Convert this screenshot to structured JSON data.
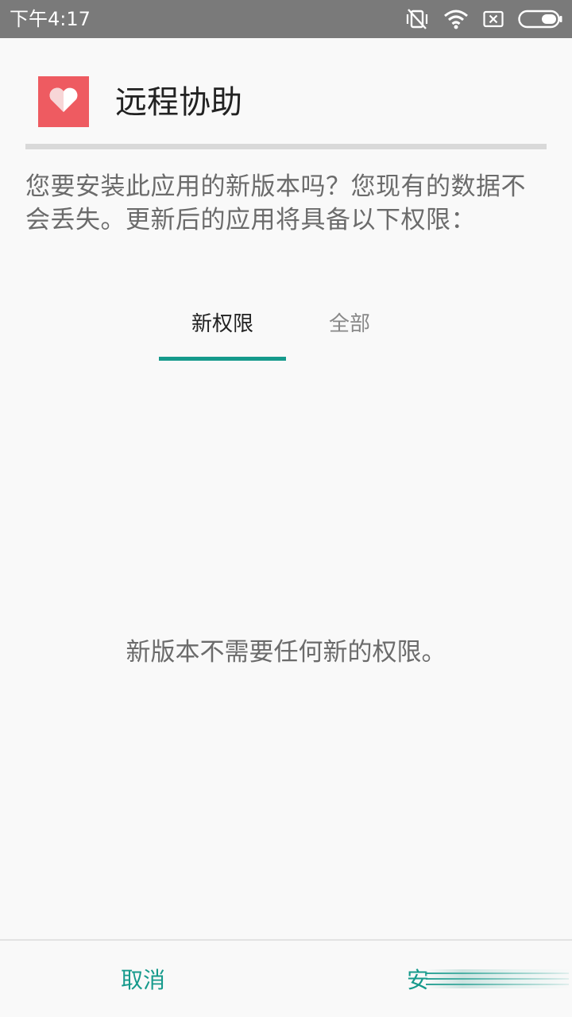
{
  "status_bar": {
    "time": "下午4:17",
    "icons": [
      "vibrate-off-icon",
      "wifi-icon",
      "sim-x-icon",
      "battery-icon"
    ]
  },
  "header": {
    "app_name": "远程协助",
    "icon": "heart-icon",
    "icon_color": "#ee5b61"
  },
  "description": "您要安装此应用的新版本吗？您现有的数据不会丢失。更新后的应用将具备以下权限：",
  "tabs": [
    {
      "label": "新权限",
      "selected": true
    },
    {
      "label": "全部",
      "selected": false
    }
  ],
  "empty_message": "新版本不需要任何新的权限。",
  "footer": {
    "cancel_label": "取消",
    "install_label": "安"
  },
  "colors": {
    "accent": "#169a8c",
    "status_bar": "#7a7a7a",
    "background": "#f9f9f9"
  }
}
